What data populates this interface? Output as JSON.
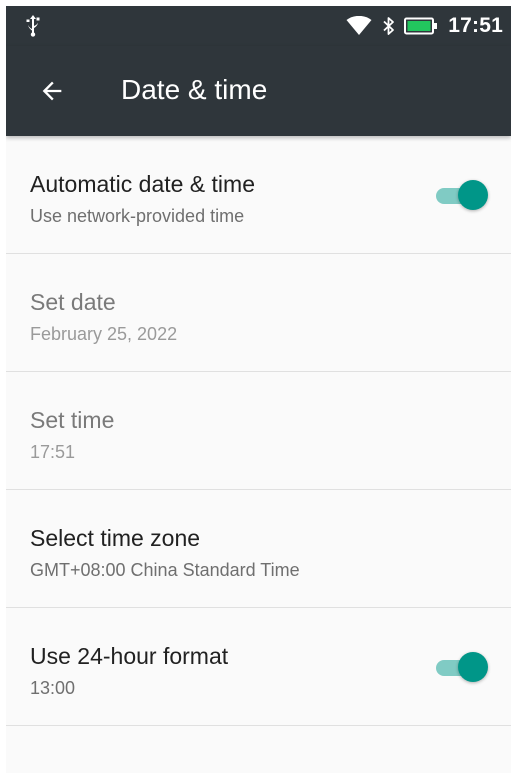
{
  "status_bar": {
    "time": "17:51",
    "icons": [
      "usb-icon",
      "wifi-icon",
      "bluetooth-icon",
      "battery-icon"
    ],
    "battery_color": "#22c55e"
  },
  "app_bar": {
    "title": "Date & time",
    "back_icon": "arrow-back-icon",
    "background": "#2f363b"
  },
  "settings": [
    {
      "title": "Automatic date & time",
      "subtitle": "Use network-provided time",
      "toggle": true,
      "enabled": true
    },
    {
      "title": "Set date",
      "subtitle": "February 25, 2022",
      "toggle": null,
      "enabled": false
    },
    {
      "title": "Set time",
      "subtitle": "17:51",
      "toggle": null,
      "enabled": false
    },
    {
      "title": "Select time zone",
      "subtitle": "GMT+08:00 China Standard Time",
      "toggle": null,
      "enabled": true
    },
    {
      "title": "Use 24-hour format",
      "subtitle": "13:00",
      "toggle": true,
      "enabled": true
    }
  ],
  "accent_color": "#009688",
  "accent_track_color": "#80cbc4"
}
